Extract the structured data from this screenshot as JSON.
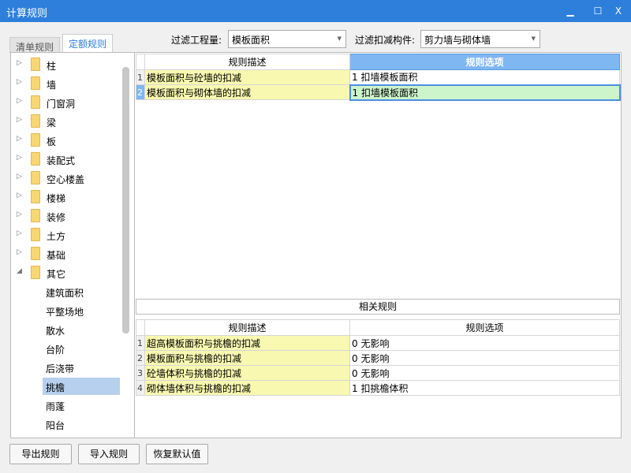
{
  "window": {
    "title": "计算规则",
    "minimize": "▁",
    "maximize": "☐",
    "close": "X"
  },
  "tabs": [
    {
      "label": "清单规则",
      "active": false
    },
    {
      "label": "定额规则",
      "active": true
    }
  ],
  "filters": {
    "quantity_label": "过滤工程量:",
    "quantity_value": "模板面积",
    "component_label": "过滤扣减构件:",
    "component_value": "剪力墙与砌体墙"
  },
  "tree": {
    "folders": [
      "柱",
      "墙",
      "门窗洞",
      "梁",
      "板",
      "装配式",
      "空心楼盖",
      "楼梯",
      "装修",
      "土方",
      "基础",
      "其它"
    ],
    "children": [
      "建筑面积",
      "平整场地",
      "散水",
      "台阶",
      "后浇带",
      "挑檐",
      "雨蓬",
      "阳台"
    ],
    "selected": "挑檐"
  },
  "main_grid": {
    "headers": [
      "规则描述",
      "规则选项"
    ],
    "rows": [
      {
        "num": "1",
        "desc": "模板面积与砼墙的扣减",
        "option": "1  扣墙模板面积"
      },
      {
        "num": "2",
        "desc": "模板面积与砌体墙的扣减",
        "option": "1  扣墙模板面积"
      }
    ]
  },
  "related_label": "相关规则",
  "related_grid": {
    "headers": [
      "规则描述",
      "规则选项"
    ],
    "rows": [
      {
        "num": "1",
        "desc": "超高模板面积与挑檐的扣减",
        "option": "0   无影响"
      },
      {
        "num": "2",
        "desc": "模板面积与挑檐的扣减",
        "option": "0   无影响"
      },
      {
        "num": "3",
        "desc": "砼墙体积与挑檐的扣减",
        "option": "0   无影响"
      },
      {
        "num": "4",
        "desc": "砌体墙体积与挑檐的扣减",
        "option": "1  扣挑檐体积"
      }
    ]
  },
  "buttons": {
    "export": "导出规则",
    "import": "导入规则",
    "restore": "恢复默认值"
  }
}
